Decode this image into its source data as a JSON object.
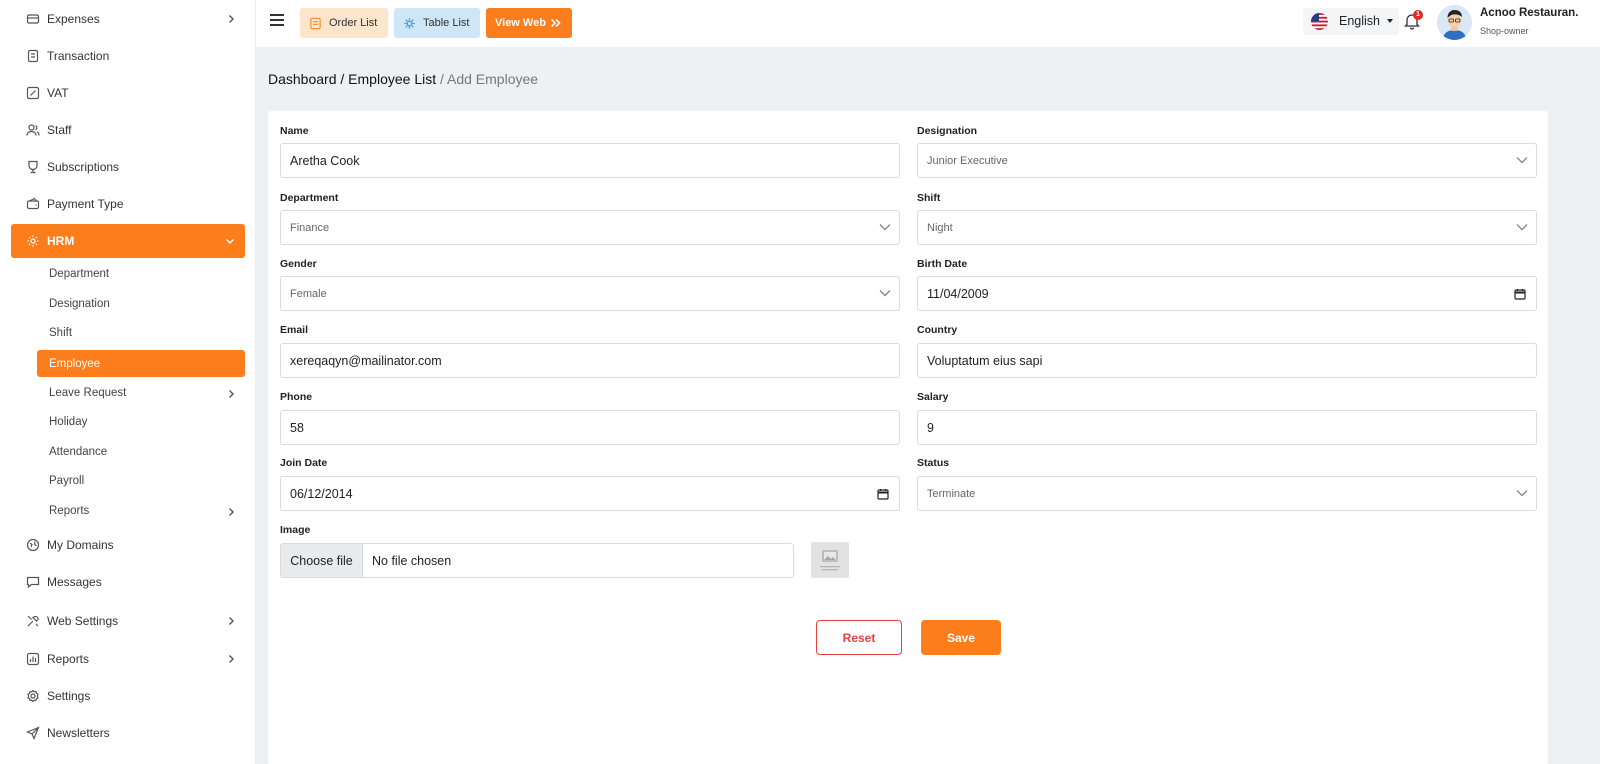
{
  "sidebar": {
    "items": [
      {
        "label": "Expenses",
        "icon": "expenses-icon"
      },
      {
        "label": "Transaction",
        "icon": "transaction-icon"
      },
      {
        "label": "VAT",
        "icon": "vat-icon"
      },
      {
        "label": "Staff",
        "icon": "staff-icon"
      },
      {
        "label": "Subscriptions",
        "icon": "subscriptions-icon"
      },
      {
        "label": "Payment Type",
        "icon": "payment-type-icon"
      },
      {
        "label": "HRM",
        "icon": "hrm-icon"
      },
      {
        "label": "My Domains",
        "icon": "domains-icon"
      },
      {
        "label": "Messages",
        "icon": "messages-icon"
      },
      {
        "label": "Web Settings",
        "icon": "web-settings-icon"
      },
      {
        "label": "Reports",
        "icon": "reports-icon"
      },
      {
        "label": "Settings",
        "icon": "settings-icon"
      },
      {
        "label": "Newsletters",
        "icon": "newsletters-icon"
      }
    ],
    "hrm_sub": [
      {
        "label": "Department"
      },
      {
        "label": "Designation"
      },
      {
        "label": "Shift"
      },
      {
        "label": "Employee"
      },
      {
        "label": "Leave Request"
      },
      {
        "label": "Holiday"
      },
      {
        "label": "Attendance"
      },
      {
        "label": "Payroll"
      },
      {
        "label": "Reports"
      }
    ]
  },
  "topbar": {
    "order_list": "Order List",
    "table_list": "Table List",
    "view_web": "View Web",
    "language": "English",
    "notification_count": "1",
    "user_name": "Acnoo Restauran.",
    "user_role": "Shop-owner"
  },
  "breadcrumb": {
    "dashboard": "Dashboard",
    "sep1": " / ",
    "employee_list": "Employee List",
    "current": " / Add Employee"
  },
  "form": {
    "name": {
      "label": "Name",
      "value": "Aretha Cook"
    },
    "designation": {
      "label": "Designation",
      "value": "Junior Executive"
    },
    "department": {
      "label": "Department",
      "value": "Finance"
    },
    "shift": {
      "label": "Shift",
      "value": "Night"
    },
    "gender": {
      "label": "Gender",
      "value": "Female"
    },
    "birth_date": {
      "label": "Birth Date",
      "value": "11/04/2009"
    },
    "email": {
      "label": "Email",
      "value": "xereqaqyn@mailinator.com"
    },
    "country": {
      "label": "Country",
      "value": "Voluptatum eius sapi"
    },
    "phone": {
      "label": "Phone",
      "value": "58"
    },
    "salary": {
      "label": "Salary",
      "value": "9"
    },
    "join_date": {
      "label": "Join Date",
      "value": "06/12/2014"
    },
    "status": {
      "label": "Status",
      "value": "Terminate"
    },
    "image": {
      "label": "Image",
      "button": "Choose file",
      "status": "No file chosen"
    },
    "reset": "Reset",
    "save": "Save"
  },
  "colors": {
    "accent": "#fb7d1c",
    "danger": "#e44141",
    "background": "#eef0f4"
  }
}
